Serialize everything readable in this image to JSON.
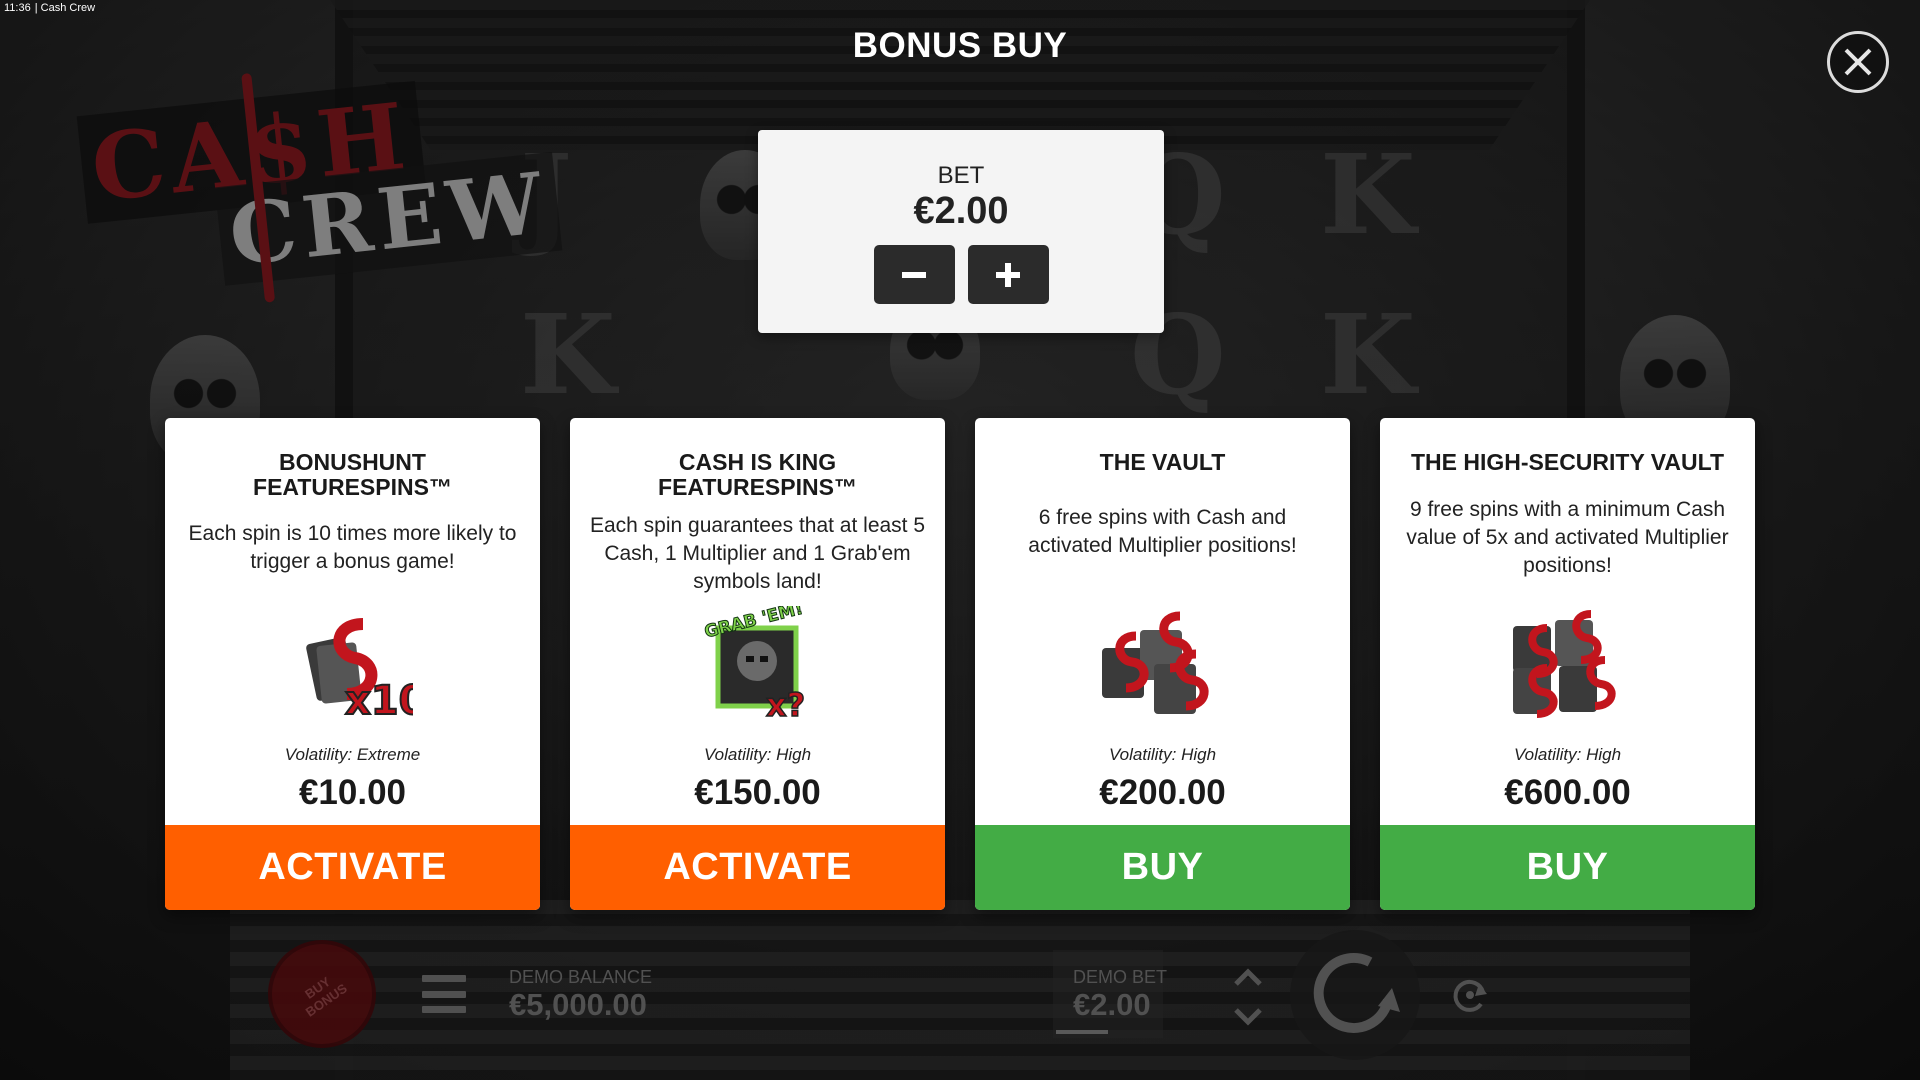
{
  "system": {
    "time": "11:36",
    "app_name": "Cash Crew"
  },
  "logo": {
    "line1": "CA$H",
    "line2": "CREW"
  },
  "dialog": {
    "title": "BONUS BUY",
    "close_icon": "close-icon"
  },
  "bet": {
    "label": "BET",
    "value": "€2.00",
    "decrease_icon": "minus-icon",
    "increase_icon": "plus-icon"
  },
  "cards": [
    {
      "title_line1": "BONUSHUNT",
      "title_line2": "FEATURESPINS™",
      "description": "Each spin is 10 times more likely to trigger a bonus game!",
      "art_icon": "cash-x10-icon",
      "volatility": "Volatility: Extreme",
      "price": "€10.00",
      "action": "ACTIVATE"
    },
    {
      "title_line1": "CASH IS KING",
      "title_line2": "FEATURESPINS™",
      "description": "Each spin guarantees that at least 5 Cash, 1 Multiplier and 1 Grab'em symbols land!",
      "art_icon": "grab-em-icon",
      "art_text": "GRAB 'EM!",
      "art_mult": "x?",
      "volatility": "Volatility: High",
      "price": "€150.00",
      "action": "ACTIVATE"
    },
    {
      "title_line1": "THE VAULT",
      "title_line2": "",
      "description": "6 free spins with Cash and activated Multiplier positions!",
      "art_icon": "cash-stack-icon",
      "volatility": "Volatility: High",
      "price": "€200.00",
      "action": "BUY"
    },
    {
      "title_line1": "THE HIGH-SECURITY VAULT",
      "title_line2": "",
      "description": "9 free spins with a minimum Cash value of 5x and activated Multiplier positions!",
      "art_icon": "cash-stack-large-icon",
      "volatility": "Volatility: High",
      "price": "€600.00",
      "action": "BUY"
    }
  ],
  "hud": {
    "buy_bonus_line1": "BUY",
    "buy_bonus_line2": "BONUS",
    "balance_label": "DEMO BALANCE",
    "balance_value": "€5,000.00",
    "bet_label": "DEMO BET",
    "bet_value": "€2.00"
  },
  "colors": {
    "activate": "#ff5f00",
    "buy": "#43ac45",
    "card_bg": "#ffffff",
    "logo_red": "#9c1d24"
  }
}
